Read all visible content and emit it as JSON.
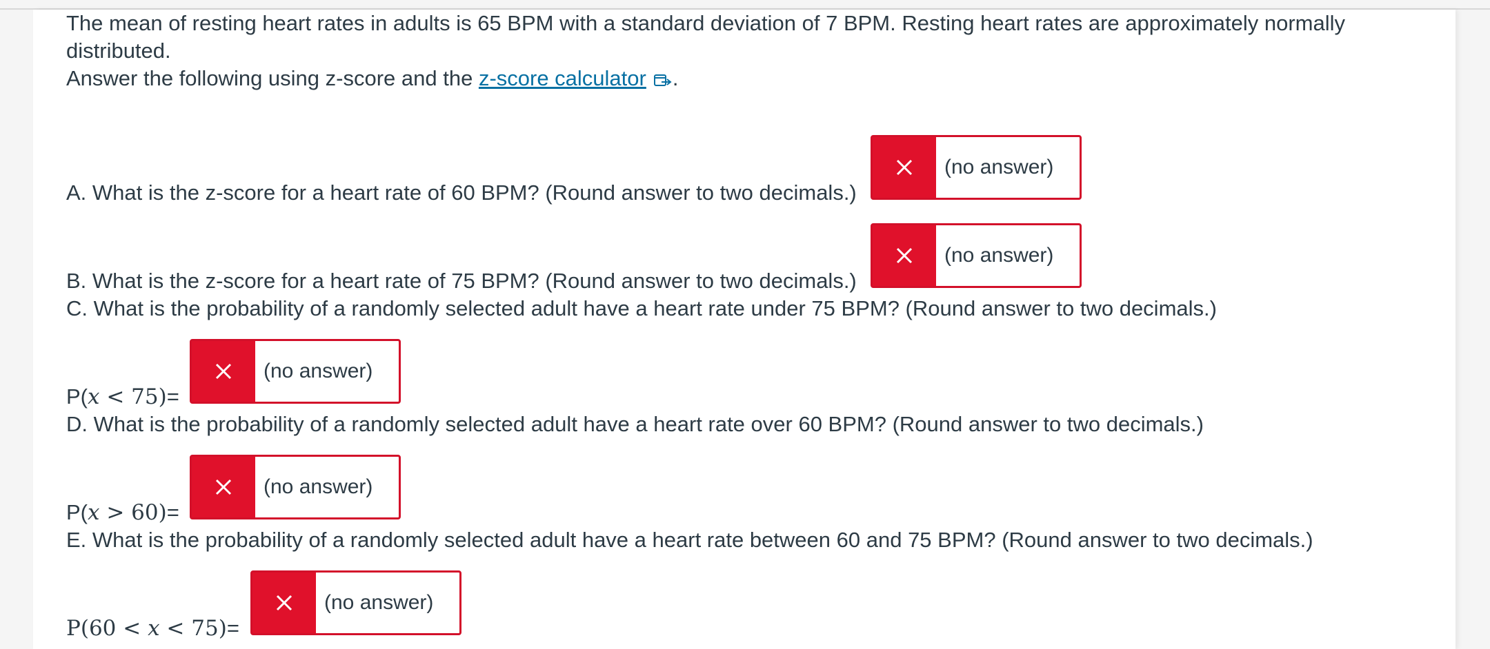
{
  "intro": {
    "paragraph": "The mean of resting heart rates in adults is 65 BPM with a standard deviation of 7 BPM. Resting heart rates are approximately normally distributed.",
    "instruction_prefix": "Answer the following using z-score and the ",
    "link_text": "z-score calculator",
    "instruction_suffix": "."
  },
  "questions": {
    "a": {
      "text": "A.  What is the z-score for a heart rate of 60 BPM? (Round answer to two decimals.)",
      "answer": "(no answer)"
    },
    "b": {
      "text": "B.  What is the z-score for a heart rate of 75 BPM? (Round answer to two decimals.)",
      "answer": "(no answer)"
    },
    "c": {
      "text": "C. What is the probability of a randomly selected adult have a heart rate under 75 BPM? (Round answer to two decimals.)",
      "prob_open": "P(",
      "prob_var": "x",
      "prob_rest": " < 75)",
      "prob_eq": "=",
      "answer": "(no answer)"
    },
    "d": {
      "text": "D. What is the probability of a randomly selected adult have a heart rate over 60 BPM? (Round answer to two decimals.)",
      "prob_open": "P(",
      "prob_var": "x",
      "prob_rest": " > 60)",
      "prob_eq": "=",
      "answer": "(no answer)"
    },
    "e": {
      "text": "E. What is the probability of a randomly selected adult have a heart rate between 60 and 75 BPM? (Round answer to two decimals.)",
      "prob_open": "P(60 < ",
      "prob_var": "x",
      "prob_rest": " < 75)",
      "prob_eq": "=",
      "answer": "(no answer)"
    }
  },
  "colors": {
    "incorrect": "#e0112b",
    "link": "#0770a3",
    "text": "#2d3b45"
  },
  "icons": {
    "incorrect_mark": "close-icon",
    "external_link": "external-link-icon"
  }
}
